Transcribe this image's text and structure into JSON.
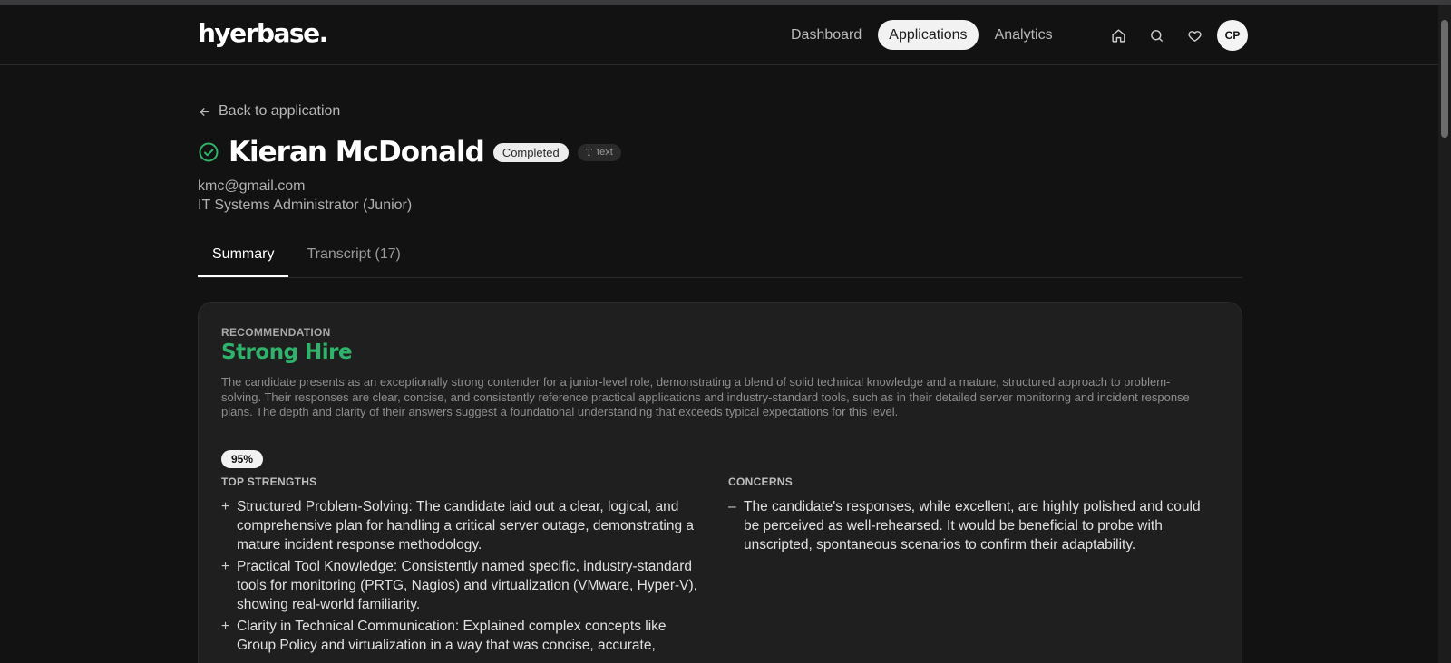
{
  "app": {
    "logo": "hyerbase.",
    "nav": [
      {
        "label": "Dashboard",
        "active": false
      },
      {
        "label": "Applications",
        "active": true
      },
      {
        "label": "Analytics",
        "active": false
      }
    ],
    "icons": [
      "home-icon",
      "search-icon",
      "heart-icon"
    ],
    "avatar_initials": "CP"
  },
  "page": {
    "back_label": "Back to application",
    "candidate_name": "Kieran McDonald",
    "status_badge": "Completed",
    "type_badge": "text",
    "type_badge_glyph": "T",
    "email": "kmc@gmail.com",
    "role": "IT Systems Administrator (Junior)",
    "tabs": [
      {
        "label": "Summary",
        "active": true
      },
      {
        "label": "Transcript (17)",
        "active": false
      }
    ]
  },
  "summary": {
    "recommendation_label": "RECOMMENDATION",
    "recommendation_value": "Strong Hire",
    "description": "The candidate presents as an exceptionally strong contender for a junior-level role, demonstrating a blend of solid technical knowledge and a mature, structured approach to problem-solving. Their responses are clear, concise, and consistently reference practical applications and industry-standard tools, such as in their detailed server monitoring and incident response plans. The depth and clarity of their answers suggest a foundational understanding that exceeds typical expectations for this level.",
    "score": "95%",
    "strengths_label": "TOP STRENGTHS",
    "strengths": [
      "Structured Problem-Solving: The candidate laid out a clear, logical, and comprehensive plan for handling a critical server outage, demonstrating a mature incident response methodology.",
      "Practical Tool Knowledge: Consistently named specific, industry-standard tools for monitoring (PRTG, Nagios) and virtualization (VMware, Hyper-V), showing real-world familiarity.",
      "Clarity in Technical Communication: Explained complex concepts like Group Policy and virtualization in a way that was concise, accurate,"
    ],
    "concerns_label": "CONCERNS",
    "concerns": [
      "The candidate's responses, while excellent, are highly polished and could be perceived as well-rehearsed. It would be beneficial to probe with unscripted, spontaneous scenarios to confirm their adaptability."
    ],
    "strength_marker": "+",
    "concern_marker": "–"
  },
  "colors": {
    "background": "#121212",
    "card": "#1f1f1f",
    "accent_green": "#2fb36b"
  }
}
